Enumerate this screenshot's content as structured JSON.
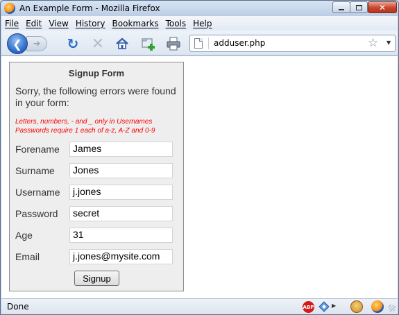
{
  "window": {
    "title": "An Example Form - Mozilla Firefox",
    "close_glyph": "✕"
  },
  "menubar": {
    "items": [
      "File",
      "Edit",
      "View",
      "History",
      "Bookmarks",
      "Tools",
      "Help"
    ]
  },
  "navbar": {
    "url": "adduser.php"
  },
  "form": {
    "title": "Signup Form",
    "error_intro": "Sorry, the following errors were found in your form:",
    "errors": [
      "Letters, numbers, - and _ only in Usernames",
      "Passwords require 1 each of a-z, A-Z and 0-9"
    ],
    "fields": [
      {
        "label": "Forename",
        "value": "James"
      },
      {
        "label": "Surname",
        "value": "Jones"
      },
      {
        "label": "Username",
        "value": "j.jones"
      },
      {
        "label": "Password",
        "value": "secret"
      },
      {
        "label": "Age",
        "value": "31"
      },
      {
        "label": "Email",
        "value": "j.jones@mysite.com"
      }
    ],
    "submit_label": "Signup"
  },
  "statusbar": {
    "text": "Done",
    "abp_label": "ABP"
  },
  "icons": {
    "back": "back-arrow-icon",
    "forward": "forward-arrow-icon",
    "reload": "reload-icon",
    "stop": "stop-icon",
    "home": "home-icon",
    "bookmark_add": "bookmark-add-icon",
    "print": "print-icon",
    "star": "star-icon"
  },
  "colors": {
    "error_text": "#ff0000",
    "form_background": "#eeeeee"
  }
}
